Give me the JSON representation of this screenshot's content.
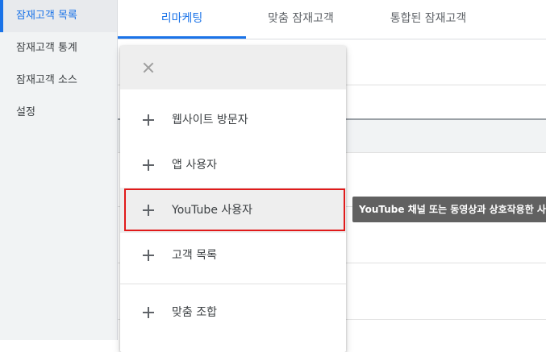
{
  "sidebar": {
    "items": [
      {
        "label": "잠재고객 목록"
      },
      {
        "label": "잠재고객 통계"
      },
      {
        "label": "잠재고객 소스"
      },
      {
        "label": "설정"
      }
    ]
  },
  "tabs": [
    {
      "label": "리마케팅"
    },
    {
      "label": "맞춤 잠재고객"
    },
    {
      "label": "통합된 잠재고객"
    }
  ],
  "menu": {
    "close_icon": "close-icon",
    "items": [
      {
        "label": "웹사이트 방문자",
        "icon": "plus-icon"
      },
      {
        "label": "앱 사용자",
        "icon": "plus-icon"
      },
      {
        "label": "YouTube 사용자",
        "icon": "plus-icon"
      },
      {
        "label": "고객 목록",
        "icon": "plus-icon"
      },
      {
        "label": "맞춤 조합",
        "icon": "plus-icon"
      }
    ]
  },
  "tooltip": {
    "text": "YouTube 채널 또는 동영상과 상호작용한 사"
  },
  "colors": {
    "accent": "#1a73e8",
    "highlight": "#e01a1a",
    "tooltip_bg": "#616161"
  }
}
